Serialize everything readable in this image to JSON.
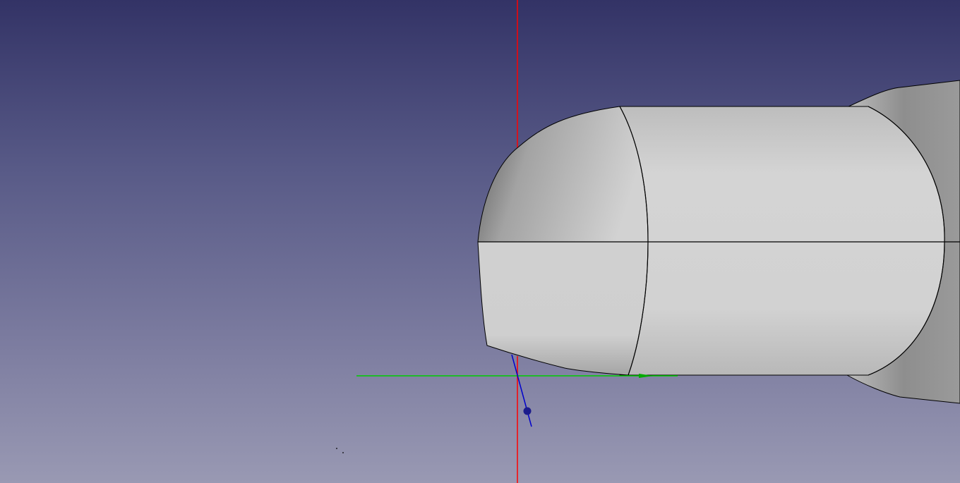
{
  "view": {
    "background_top": "#333366",
    "background_bottom": "#9999b3"
  },
  "model": {
    "face_light": "#d4d4d4",
    "face_mid": "#bfbfbf",
    "face_dark": "#6e6e6e",
    "edge_color": "#000000"
  },
  "axes": {
    "x_axis_color": "#ff0000",
    "y_axis_color": "#00cc00",
    "z_axis_color": "#0000cc"
  }
}
